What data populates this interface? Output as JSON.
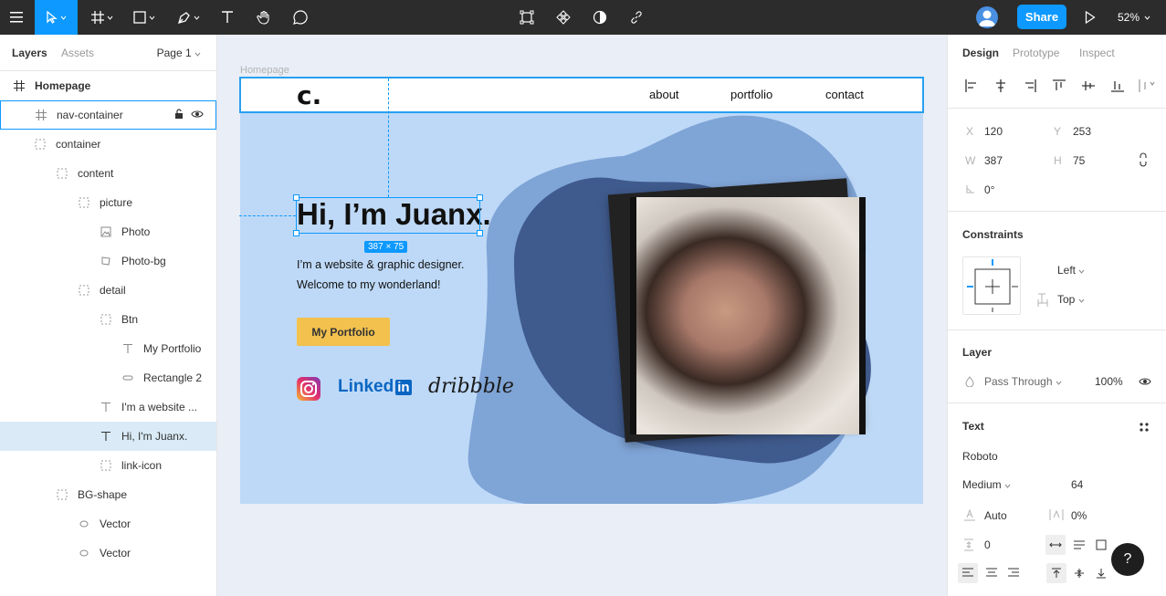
{
  "toolbar": {
    "share_label": "Share",
    "zoom": "52%"
  },
  "left_panel": {
    "tabs": [
      "Layers",
      "Assets"
    ],
    "page": "Page 1",
    "layers": [
      {
        "label": "Homepage",
        "icon": "frame-icon"
      },
      {
        "label": "nav-container",
        "icon": "frame-icon"
      },
      {
        "label": "container",
        "icon": "group-icon"
      },
      {
        "label": "content",
        "icon": "group-icon"
      },
      {
        "label": "picture",
        "icon": "group-icon"
      },
      {
        "label": "Photo",
        "icon": "image-icon"
      },
      {
        "label": "Photo-bg",
        "icon": "shape-icon"
      },
      {
        "label": "detail",
        "icon": "group-icon"
      },
      {
        "label": "Btn",
        "icon": "group-icon"
      },
      {
        "label": "My Portfolio",
        "icon": "text-icon"
      },
      {
        "label": "Rectangle 2",
        "icon": "rectangle-icon"
      },
      {
        "label": "I'm a website ...",
        "icon": "text-icon"
      },
      {
        "label": "Hi, I'm Juanx.",
        "icon": "text-icon"
      },
      {
        "label": "link-icon",
        "icon": "group-icon"
      },
      {
        "label": "BG-shape",
        "icon": "group-icon"
      },
      {
        "label": "Vector",
        "icon": "vector-icon"
      },
      {
        "label": "Vector",
        "icon": "vector-icon"
      }
    ]
  },
  "canvas": {
    "frame_label": "Homepage",
    "logo": "c.",
    "nav_links": [
      "about",
      "portfolio",
      "contact"
    ],
    "heading": "Hi, I’m Juanx.",
    "subtext_line1": "I’m a website & graphic designer.",
    "subtext_line2": "Welcome to my wonderland!",
    "button_label": "My Portfolio",
    "linkedin_text": "Linked",
    "linkedin_in": "in",
    "dribbble_text": "dribbble",
    "dimension_badge": "387 × 75"
  },
  "right_panel": {
    "tabs": [
      "Design",
      "Prototype",
      "Inspect"
    ],
    "x_label": "X",
    "x_value": "120",
    "y_label": "Y",
    "y_value": "253",
    "w_label": "W",
    "w_value": "387",
    "h_label": "H",
    "h_value": "75",
    "rotation": "0°",
    "constraints_title": "Constraints",
    "constraint_h": "Left",
    "constraint_v": "Top",
    "layer_title": "Layer",
    "blend_mode": "Pass Through",
    "opacity": "100%",
    "text_title": "Text",
    "font_family": "Roboto",
    "font_weight": "Medium",
    "font_size": "64",
    "line_height": "Auto",
    "letter_spacing": "0%",
    "paragraph_spacing": "0",
    "help": "?"
  },
  "colors": {
    "accent": "#0d99ff",
    "toolbar_bg": "#2c2c2c",
    "artboard_bg": "#bed9f7",
    "blob_light": "#7fa4d6",
    "blob_dark": "#3f5a8c",
    "button_yellow": "#f2c14e"
  }
}
